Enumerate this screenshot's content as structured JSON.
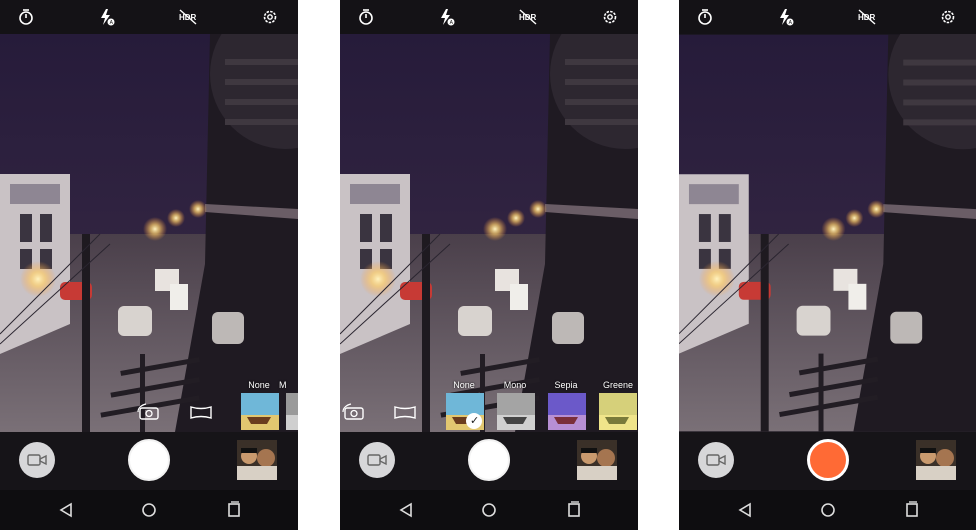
{
  "screens": [
    {
      "topbar": {
        "timer_icon": "timer-icon",
        "flash_icon": "flash-auto-icon",
        "hdr_icon": "hdr-off-icon",
        "settings_icon": "gear-icon"
      },
      "filters": [
        {
          "label": "None"
        },
        {
          "label": "M"
        }
      ],
      "bottom": {
        "video_icon": "video-camera-icon",
        "shutter_state": "photo"
      }
    },
    {
      "topbar": {
        "timer_icon": "timer-icon",
        "flash_icon": "flash-auto-icon",
        "hdr_icon": "hdr-off-icon",
        "settings_icon": "gear-icon"
      },
      "filters": [
        {
          "label": "None",
          "selected": true
        },
        {
          "label": "Mono"
        },
        {
          "label": "Sepia"
        },
        {
          "label": "Greene"
        }
      ],
      "bottom": {
        "video_icon": "video-camera-icon",
        "shutter_state": "photo"
      }
    },
    {
      "topbar": {
        "timer_icon": "timer-icon",
        "flash_icon": "flash-auto-icon",
        "hdr_icon": "hdr-off-icon",
        "settings_icon": "gear-icon"
      },
      "filters": [],
      "bottom": {
        "video_icon": "video-camera-icon",
        "shutter_state": "recording"
      }
    }
  ],
  "colors": {
    "record": "#ff6a35",
    "shutter": "#ffffff",
    "bar": "#141216"
  }
}
